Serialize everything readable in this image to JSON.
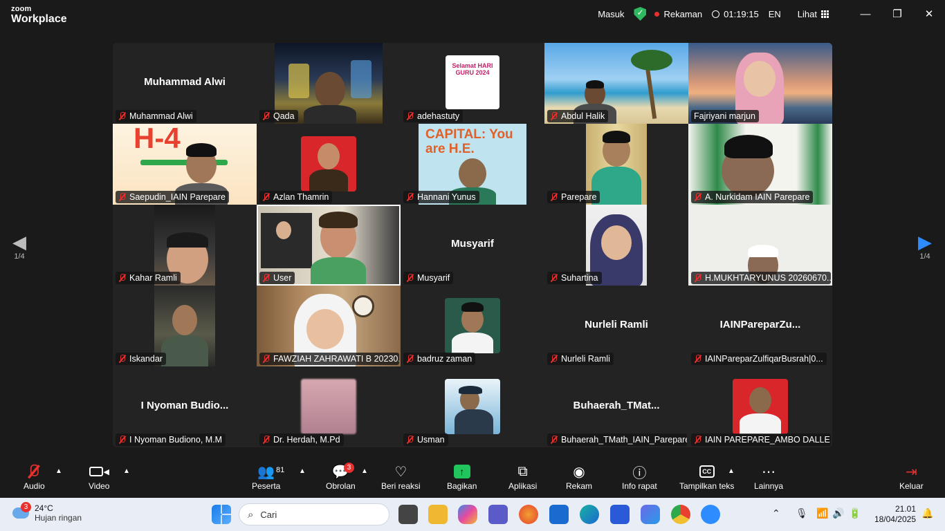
{
  "app": {
    "brand_top": "zoom",
    "brand_bottom": "Workplace"
  },
  "titlebar": {
    "signin": "Masuk",
    "recording": "Rekaman",
    "timer": "01:19:15",
    "language": "EN",
    "view": "Lihat",
    "minimize": "—",
    "restore": "❐",
    "close": "✕"
  },
  "pagination": {
    "left": "1/4",
    "right": "1/4",
    "left_arrow": "◀",
    "right_arrow": "▶"
  },
  "participants": [
    {
      "name": "Muhammad Alwi",
      "display": "Muhammad Alwi"
    },
    {
      "name": "Qada"
    },
    {
      "name": "adehastuty"
    },
    {
      "name": "Abdul Halik"
    },
    {
      "name": "Fajriyani marjun"
    },
    {
      "name": "Saepudin_IAIN Parepare"
    },
    {
      "name": "Azlan Thamrin"
    },
    {
      "name": "Hannani Yunus"
    },
    {
      "name": "Parepare"
    },
    {
      "name": "A. Nurkidam IAIN Parepare"
    },
    {
      "name": "Kahar Ramli"
    },
    {
      "name": "User"
    },
    {
      "name": "Musyarif",
      "display": "Musyarif"
    },
    {
      "name": "Suhartina"
    },
    {
      "name": "H.MUKHTARYUNUS 20260670..."
    },
    {
      "name": "Iskandar"
    },
    {
      "name": "FAWZIAH ZAHRAWATI B 20230..."
    },
    {
      "name": "badruz zaman"
    },
    {
      "name": "Nurleli Ramli",
      "display": "Nurleli Ramli"
    },
    {
      "name": "IAINPareparZulfiqarBusrah|0...",
      "display": "IAINPareparZu..."
    },
    {
      "name": "I Nyoman Budiono, M.M",
      "display": "I Nyoman Budio..."
    },
    {
      "name": "Dr. Herdah, M.Pd"
    },
    {
      "name": "Usman"
    },
    {
      "name": "Buhaerah_TMath_IAIN_Parepare",
      "display": "Buhaerah_TMat..."
    },
    {
      "name": "IAIN PAREPARE_AMBO DALLE"
    }
  ],
  "posters": {
    "guru": "Selamat HARI GURU 2024",
    "hday": "H-4",
    "capital": "CAPITAL: You are H.E."
  },
  "toolbar": {
    "audio": "Audio",
    "video": "Video",
    "participants": "Peserta",
    "participants_count": "81",
    "chat": "Obrolan",
    "chat_badge": "3",
    "react": "Beri reaksi",
    "share": "Bagikan",
    "apps": "Aplikasi",
    "record": "Rekam",
    "info": "Info rapat",
    "captions": "Tampilkan teks",
    "more": "Lainnya",
    "leave": "Keluar"
  },
  "taskbar": {
    "weather_badge": "3",
    "temperature": "24°C",
    "condition": "Hujan ringan",
    "search_placeholder": "Cari",
    "time": "21.01",
    "date": "18/04/2025"
  }
}
